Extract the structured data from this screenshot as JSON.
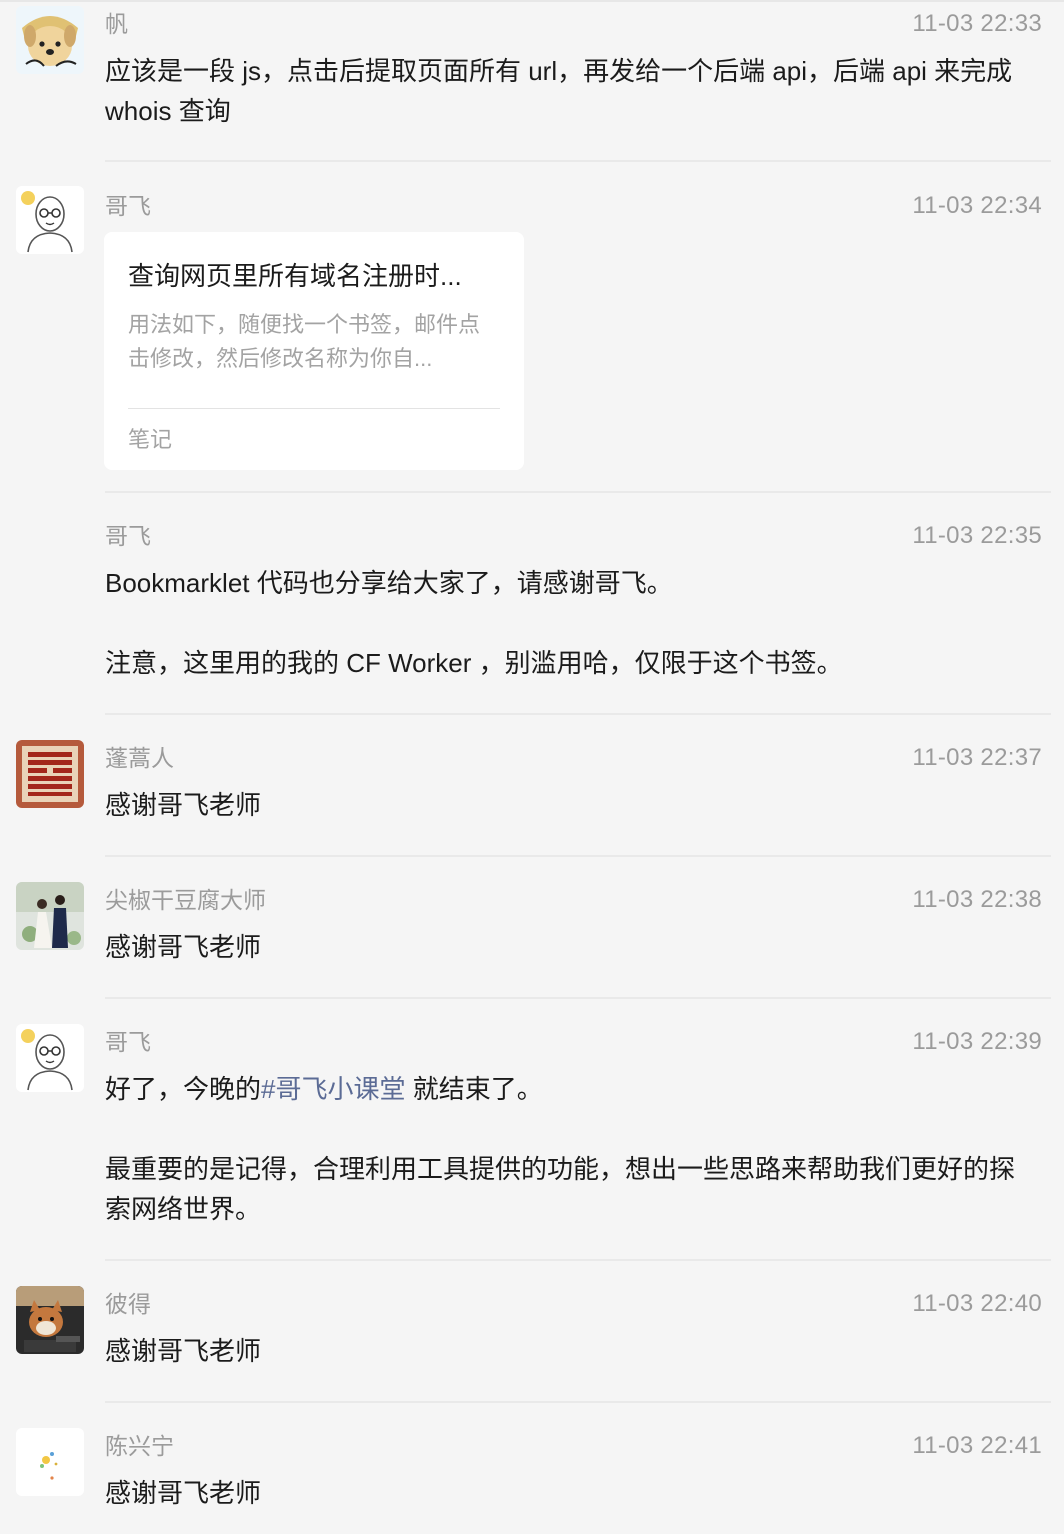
{
  "messages": [
    {
      "sender": "帆",
      "time": "11-03 22:33",
      "text": "应该是一段 js，点击后提取页面所有 url，再发给一个后端 api，后端 api 来完成 whois 查询"
    },
    {
      "sender": "哥飞",
      "time": "11-03 22:34",
      "card": {
        "title": "查询网页里所有域名注册时...",
        "desc": "用法如下，随便找一个书签，邮件点击修改，然后修改名称为你自...",
        "source": "笔记"
      }
    },
    {
      "sender": "哥飞",
      "time": "11-03 22:35",
      "text": "Bookmarklet 代码也分享给大家了，请感谢哥飞。\n\n注意，这里用的我的 CF Worker ，别滥用哈，仅限于这个书签。"
    },
    {
      "sender": "蓬蒿人",
      "time": "11-03 22:37",
      "text": "感谢哥飞老师"
    },
    {
      "sender": "尖椒干豆腐大师",
      "time": "11-03 22:38",
      "text": "感谢哥飞老师"
    },
    {
      "sender": "哥飞",
      "time": "11-03 22:39",
      "text_before": "好了，今晚的",
      "hashtag": "#哥飞小课堂",
      "text_after": " 就结束了。\n\n最重要的是记得，合理利用工具提供的功能，想出一些思路来帮助我们更好的探索网络世界。"
    },
    {
      "sender": "彼得",
      "time": "11-03 22:40",
      "text": "感谢哥飞老师"
    },
    {
      "sender": "陈兴宁",
      "time": "11-03 22:41",
      "text": "感谢哥飞老师"
    }
  ]
}
